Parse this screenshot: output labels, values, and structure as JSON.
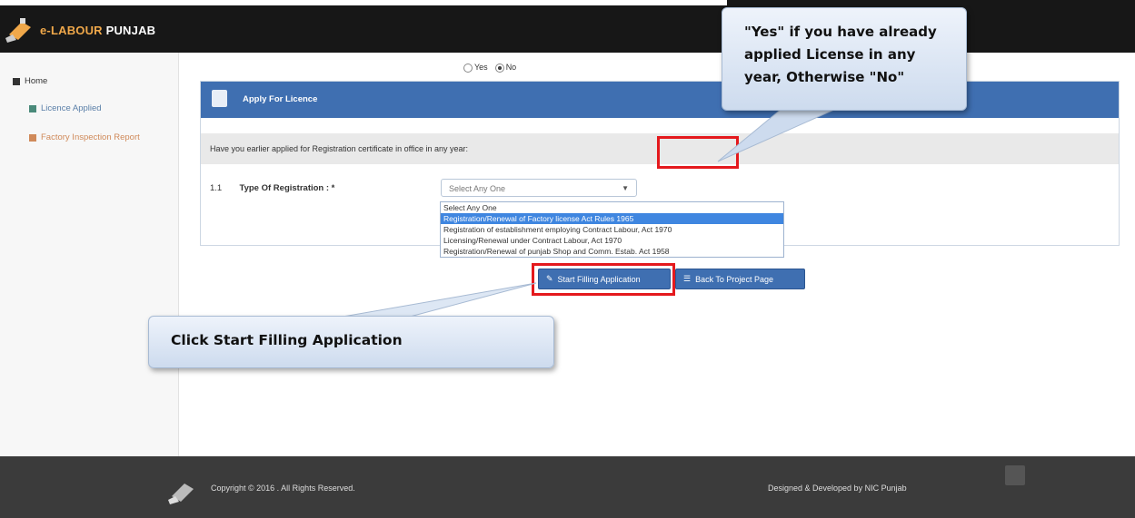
{
  "header": {
    "brand_prefix": "e-",
    "brand_labour": "LABOUR",
    "brand_punjab": "PUNJAB"
  },
  "sidebar": {
    "items": [
      {
        "label": "Home"
      },
      {
        "label": "Licence Applied"
      },
      {
        "label": "Factory Inspection Report"
      }
    ]
  },
  "panel": {
    "title": "Apply For Licence",
    "question": "Have you earlier applied for Registration certificate in office in any year:",
    "options": [
      {
        "label": "Yes",
        "selected": false
      },
      {
        "label": "No",
        "selected": true
      }
    ],
    "field_number": "1.1",
    "field_label": "Type Of Registration : *",
    "select_value": "Select Any One",
    "dropdown_options": [
      "Select Any One",
      "Registration/Renewal of Factory license Act Rules 1965",
      "Registration of establishment employing Contract Labour, Act 1970",
      "Licensing/Renewal under Contract Labour, Act 1970",
      "Registration/Renewal of punjab Shop and Comm. Estab. Act 1958"
    ],
    "dropdown_selected_index": 1
  },
  "buttons": {
    "start": "Start Filling Application",
    "back": "Back To Project Page"
  },
  "callouts": {
    "top": "\"Yes\" if you have already applied License in any year, Otherwise \"No\"",
    "bottom": "Click Start Filling Application"
  },
  "footer": {
    "copyright": "Copyright © 2016 . All Rights Reserved.",
    "designed": "Designed & Developed by NIC Punjab"
  },
  "colors": {
    "accent": "#3f6fb1",
    "highlight": "#e4191d",
    "brand_orange": "#f0a84a"
  }
}
